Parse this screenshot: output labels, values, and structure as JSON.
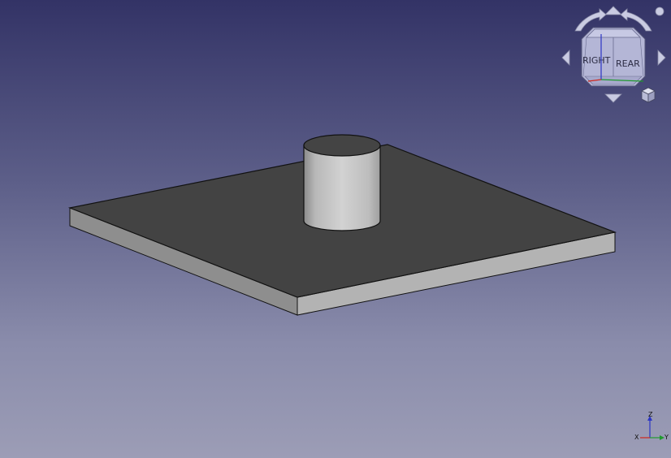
{
  "viewport": {
    "background_top": "#333366",
    "background_bottom": "#9c9db6"
  },
  "navigation_cube": {
    "face_right_label": "RIGHT",
    "face_rear_label": "REAR",
    "face_color": "#b4b6d6"
  },
  "axis_indicator": {
    "x_label": "X",
    "y_label": "Y",
    "z_label": "Z",
    "x_color": "#d0261c",
    "y_color": "#1f9a2e",
    "z_color": "#2b35c4"
  },
  "model": {
    "top_face_color": "#434343",
    "side_face_light": "#b5b5b5",
    "side_face_dark": "#8e8e8e",
    "edge_color": "#111111"
  }
}
